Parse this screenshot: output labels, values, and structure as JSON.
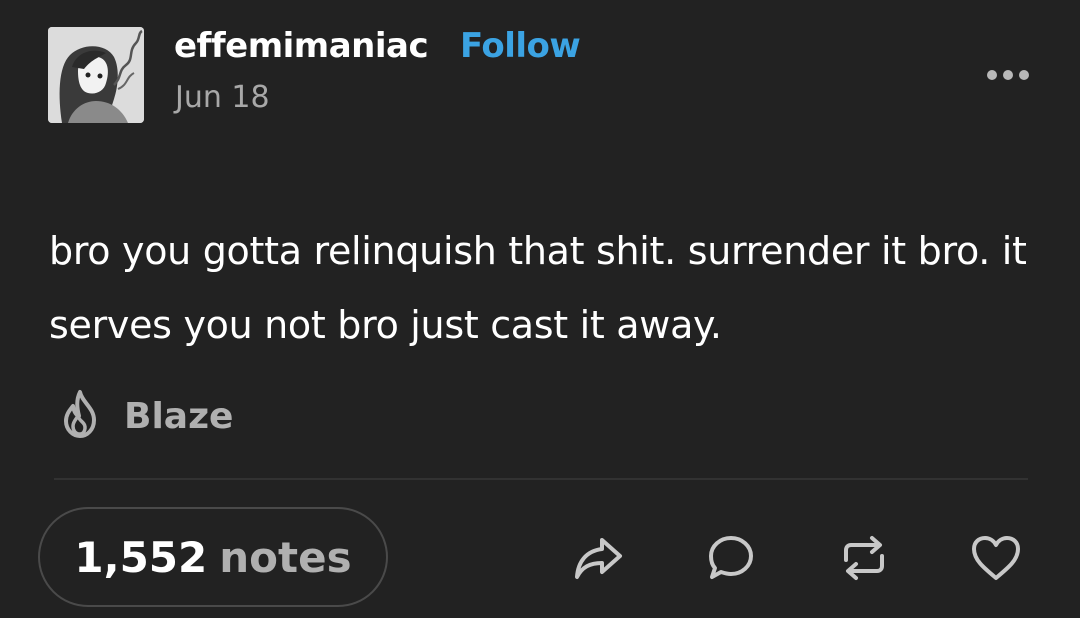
{
  "post": {
    "username": "effemimaniac",
    "follow_label": "Follow",
    "date": "Jun 18",
    "body": "bro you gotta relinquish that shit. surrender it bro. it serves you not bro just cast it away.",
    "blaze_label": "Blaze",
    "notes_count": "1,552",
    "notes_word": "notes"
  },
  "icons": {
    "more": "more-options-icon",
    "blaze": "flame-icon",
    "share": "share-icon",
    "reply": "reply-bubble-icon",
    "reblog": "reblog-icon",
    "like": "heart-icon"
  },
  "colors": {
    "background": "#222222",
    "follow_accent": "#3ba3e3",
    "muted_text": "#a8a8a8"
  }
}
